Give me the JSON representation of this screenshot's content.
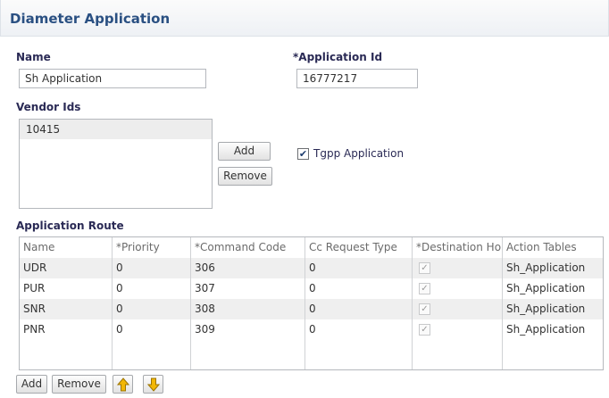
{
  "page": {
    "title": "Diameter Application"
  },
  "fields": {
    "name_label": "Name",
    "name_value": "Sh Application",
    "app_id_label": "*Application Id",
    "app_id_value": "16777217",
    "vendor_ids_label": "Vendor Ids",
    "vendor_ids": [
      "10415"
    ],
    "tgpp_label": "Tgpp Application",
    "tgpp_checked": true
  },
  "vendor_buttons": {
    "add": "Add",
    "remove": "Remove"
  },
  "route": {
    "label": "Application Route",
    "columns": [
      "Name",
      "*Priority",
      "*Command Code",
      "Cc Request Type",
      "*Destination Ho",
      "Action Tables"
    ],
    "rows": [
      {
        "name": "UDR",
        "priority": "0",
        "command_code": "306",
        "cc_request_type": "0",
        "destination_host": true,
        "action_tables": "Sh_Application"
      },
      {
        "name": "PUR",
        "priority": "0",
        "command_code": "307",
        "cc_request_type": "0",
        "destination_host": true,
        "action_tables": "Sh_Application"
      },
      {
        "name": "SNR",
        "priority": "0",
        "command_code": "308",
        "cc_request_type": "0",
        "destination_host": true,
        "action_tables": "Sh_Application"
      },
      {
        "name": "PNR",
        "priority": "0",
        "command_code": "309",
        "cc_request_type": "0",
        "destination_host": true,
        "action_tables": "Sh_Application"
      }
    ],
    "buttons": {
      "add": "Add",
      "remove": "Remove"
    },
    "icons": {
      "move_up": "arrow-up-icon",
      "move_down": "arrow-down-icon"
    }
  },
  "colors": {
    "title": "#2a5082",
    "arrow": "#f2b705"
  }
}
